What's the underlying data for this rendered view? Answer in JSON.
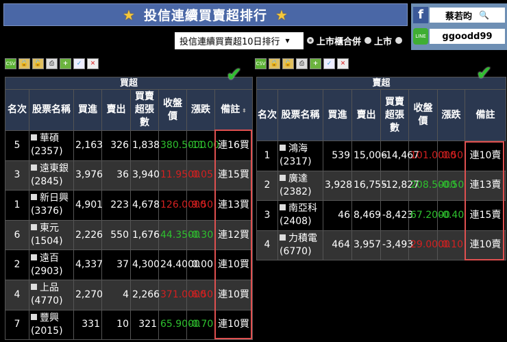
{
  "header": {
    "title": "投信連續買賣超排行",
    "star_icon": "star-icon"
  },
  "social": {
    "facebook_name": "蔡若昀",
    "line_id": "ggoodd99"
  },
  "filter": {
    "selected": "投信連續買賣超10日排行",
    "radios": [
      {
        "label": "上市櫃合併",
        "selected": true
      },
      {
        "label": "上市",
        "selected": false
      }
    ]
  },
  "toolbar": {
    "csv": "CSV"
  },
  "colors": {
    "up": "#d42020",
    "down": "#2ec12e",
    "header": "#2b3850",
    "highlight": "#e05050"
  },
  "buy_table": {
    "caption": "買超",
    "headers": [
      "名次",
      "股票名稱",
      "買進",
      "賣出",
      "買賣超張數",
      "收盤價",
      "漲跌",
      "備註"
    ],
    "rows": [
      {
        "rank": "5",
        "name": "華碩",
        "code": "(2357)",
        "buy": "2,163",
        "sell": "326",
        "net": "1,838",
        "close": "380.5000",
        "chg": "-11.00",
        "note": "連16買",
        "dir": "g"
      },
      {
        "rank": "3",
        "name": "遠東銀",
        "code": "(2845)",
        "buy": "3,976",
        "sell": "36",
        "net": "3,940",
        "close": "11.9500",
        "chg": "0.05",
        "note": "連15買",
        "dir": "r"
      },
      {
        "rank": "1",
        "name": "新日興",
        "code": "(3376)",
        "buy": "4,901",
        "sell": "223",
        "net": "4,678",
        "close": "126.0000",
        "chg": "9.50",
        "note": "連13買",
        "dir": "r"
      },
      {
        "rank": "6",
        "name": "東元",
        "code": "(1504)",
        "buy": "2,226",
        "sell": "550",
        "net": "1,676",
        "close": "44.3500",
        "chg": "-0.30",
        "note": "連12買",
        "dir": "g"
      },
      {
        "rank": "2",
        "name": "遠百",
        "code": "(2903)",
        "buy": "4,337",
        "sell": "37",
        "net": "4,300",
        "close": "24.4000",
        "chg": "0.00",
        "note": "連10買",
        "dir": "w"
      },
      {
        "rank": "4",
        "name": "上品",
        "code": "(4770)",
        "buy": "2,270",
        "sell": "4",
        "net": "2,266",
        "close": "371.0000",
        "chg": "6.50",
        "note": "連10買",
        "dir": "r"
      },
      {
        "rank": "7",
        "name": "豐興",
        "code": "(2015)",
        "buy": "331",
        "sell": "10",
        "net": "321",
        "close": "65.9000",
        "chg": "-0.70",
        "note": "連10買",
        "dir": "g"
      }
    ]
  },
  "sell_table": {
    "caption": "賣超",
    "headers": [
      "名次",
      "股票名稱",
      "買進",
      "賣出",
      "買賣超張數",
      "收盤價",
      "漲跌",
      "備註"
    ],
    "rows": [
      {
        "rank": "1",
        "name": "鴻海",
        "code": "(2317)",
        "buy": "539",
        "sell": "15,006",
        "net": "-14,467",
        "close": "101.0000",
        "chg": "0.50",
        "note": "連10賣",
        "dir": "r"
      },
      {
        "rank": "2",
        "name": "廣達",
        "code": "(2382)",
        "buy": "3,928",
        "sell": "16,755",
        "net": "-12,827",
        "close": "208.5000",
        "chg": "-0.50",
        "note": "連13賣",
        "dir": "g"
      },
      {
        "rank": "3",
        "name": "南亞科",
        "code": "(2408)",
        "buy": "46",
        "sell": "8,469",
        "net": "-8,423",
        "close": "67.2000",
        "chg": "-0.40",
        "note": "連15賣",
        "dir": "g"
      },
      {
        "rank": "4",
        "name": "力積電",
        "code": "(6770)",
        "buy": "464",
        "sell": "3,957",
        "net": "-3,493",
        "close": "29.0000",
        "chg": "0.10",
        "note": "連10賣",
        "dir": "r"
      }
    ]
  }
}
